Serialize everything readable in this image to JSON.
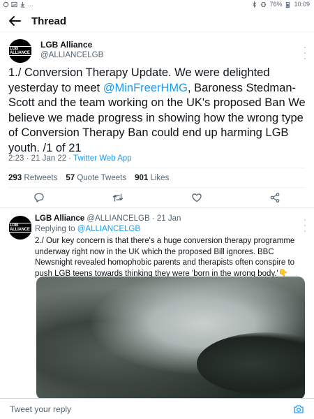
{
  "status_bar": {
    "battery": "76%",
    "time": "10:09",
    "left_more": "..."
  },
  "header": {
    "title": "Thread"
  },
  "main_tweet": {
    "name": "LGB Alliance",
    "handle": "@ALLIANCELGB",
    "avatar_text": "LGB ALLIANCE",
    "text_before_mention": "1./ Conversion Therapy Update. We were delighted yesterday to meet ",
    "mention": "@MinFreerHMG",
    "text_after_mention": ", Baroness Stedman-Scott and the team working on the UK's proposed Ban We believe we made progress in showing how the wrong type of Conversion Therapy Ban could end up harming LGB youth. /1 of 21",
    "time": "2:23 · 21 Jan 22 · ",
    "source": "Twitter Web App",
    "stats": {
      "retweets_count": "293",
      "retweets_label": "Retweets",
      "quotes_count": "57",
      "quotes_label": "Quote Tweets",
      "likes_count": "901",
      "likes_label": "Likes"
    }
  },
  "reply_tweet": {
    "name": "LGB Alliance",
    "handle_date": "@ALLIANCELGB · 21 Jan",
    "avatar_text": "LGB ALLIANCE",
    "replying_prefix": "Replying to ",
    "replying_handle": "@ALLIANCELGB",
    "text": "2./ Our key concern is that there's a huge conversion therapy programme underway right now in the UK which the proposed Bill ignores. BBC Newsnight revealed homophobic parents and therapists often conspire to push LGB teens towards thinking they were 'born in the wrong body.'",
    "emoji": "👇"
  },
  "reply_bar": {
    "placeholder": "Tweet your reply"
  },
  "colors": {
    "link": "#1d9bf0",
    "secondary_text": "#536471",
    "divider": "#eff3f4"
  },
  "icons": [
    "back-arrow-icon",
    "more-icon",
    "reply-icon",
    "retweet-icon",
    "like-icon",
    "share-icon",
    "camera-icon",
    "bluetooth-icon",
    "vibrate-icon",
    "battery-icon",
    "image-notification-icon",
    "download-icon"
  ]
}
